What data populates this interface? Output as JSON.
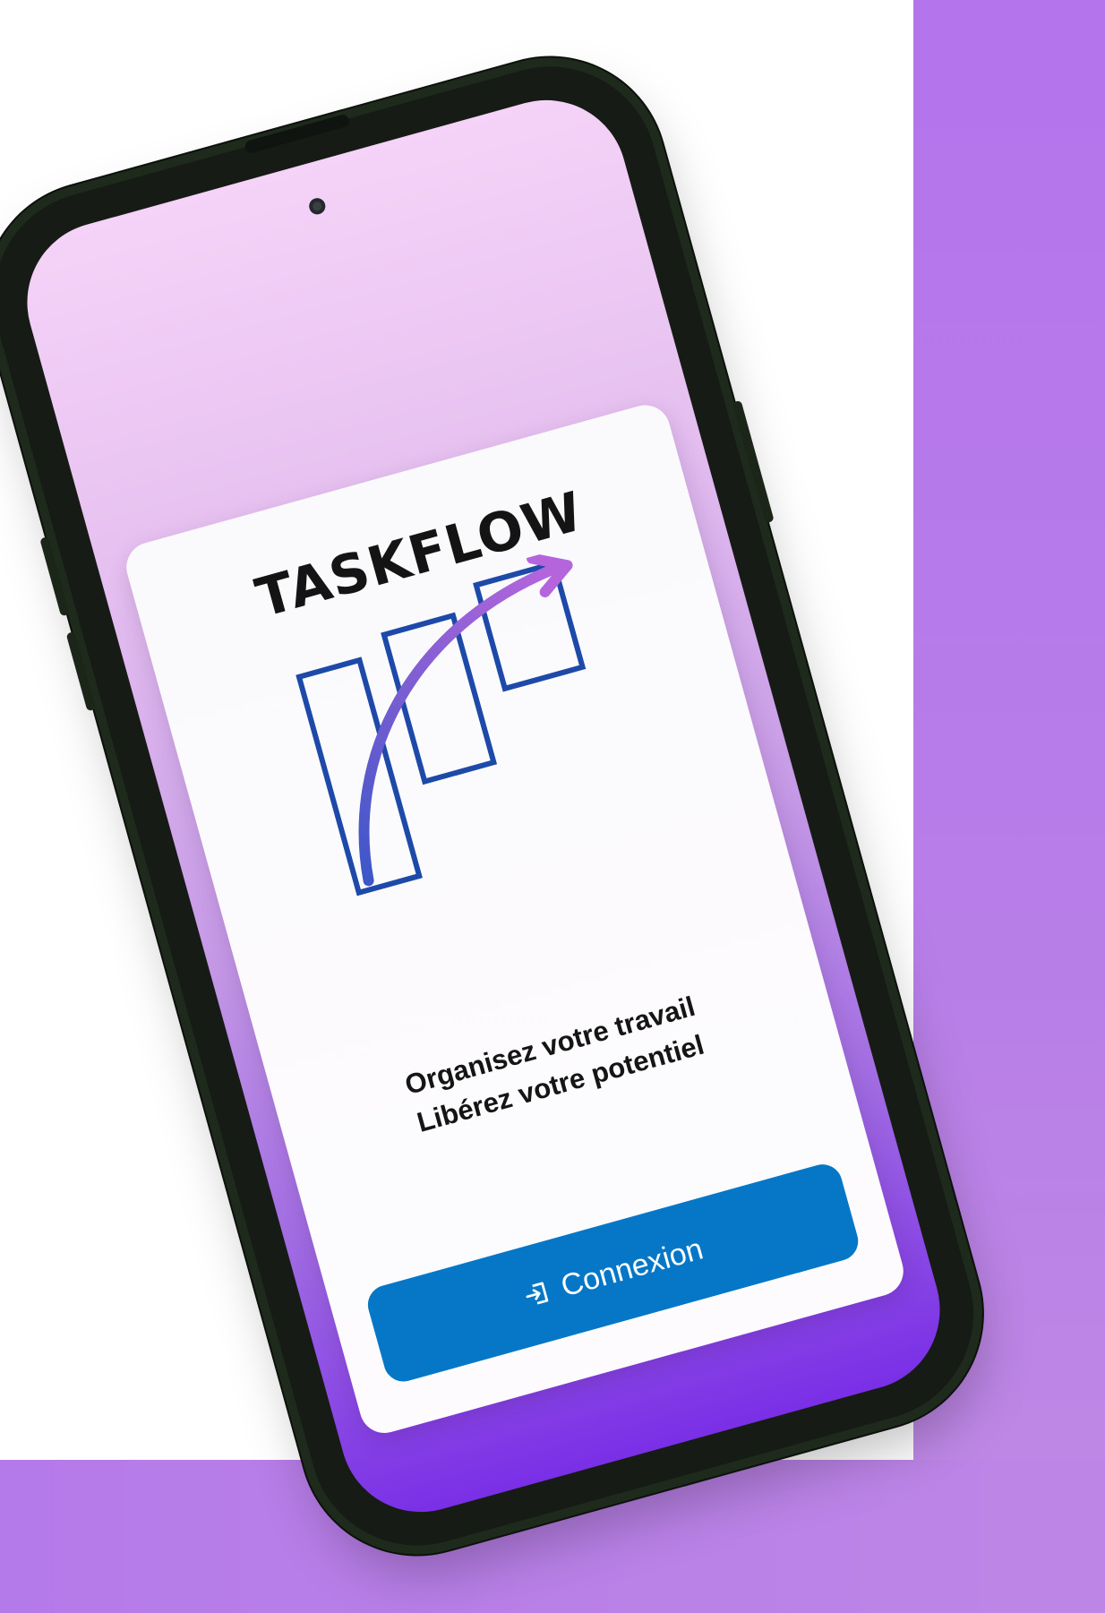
{
  "app": {
    "logo_text": "TASKFLOW"
  },
  "hero": {
    "tagline_line1": "Organisez votre travail",
    "tagline_line2": "Libérez votre potentiel"
  },
  "actions": {
    "login_label": "Connexion",
    "login_icon": "login-icon"
  },
  "colors": {
    "primary_button": "#0577c6",
    "logo_outline": "#1d49a8",
    "arrow_start": "#3d57c8",
    "arrow_end": "#b565dc",
    "background_accent": "#b57ae9"
  }
}
